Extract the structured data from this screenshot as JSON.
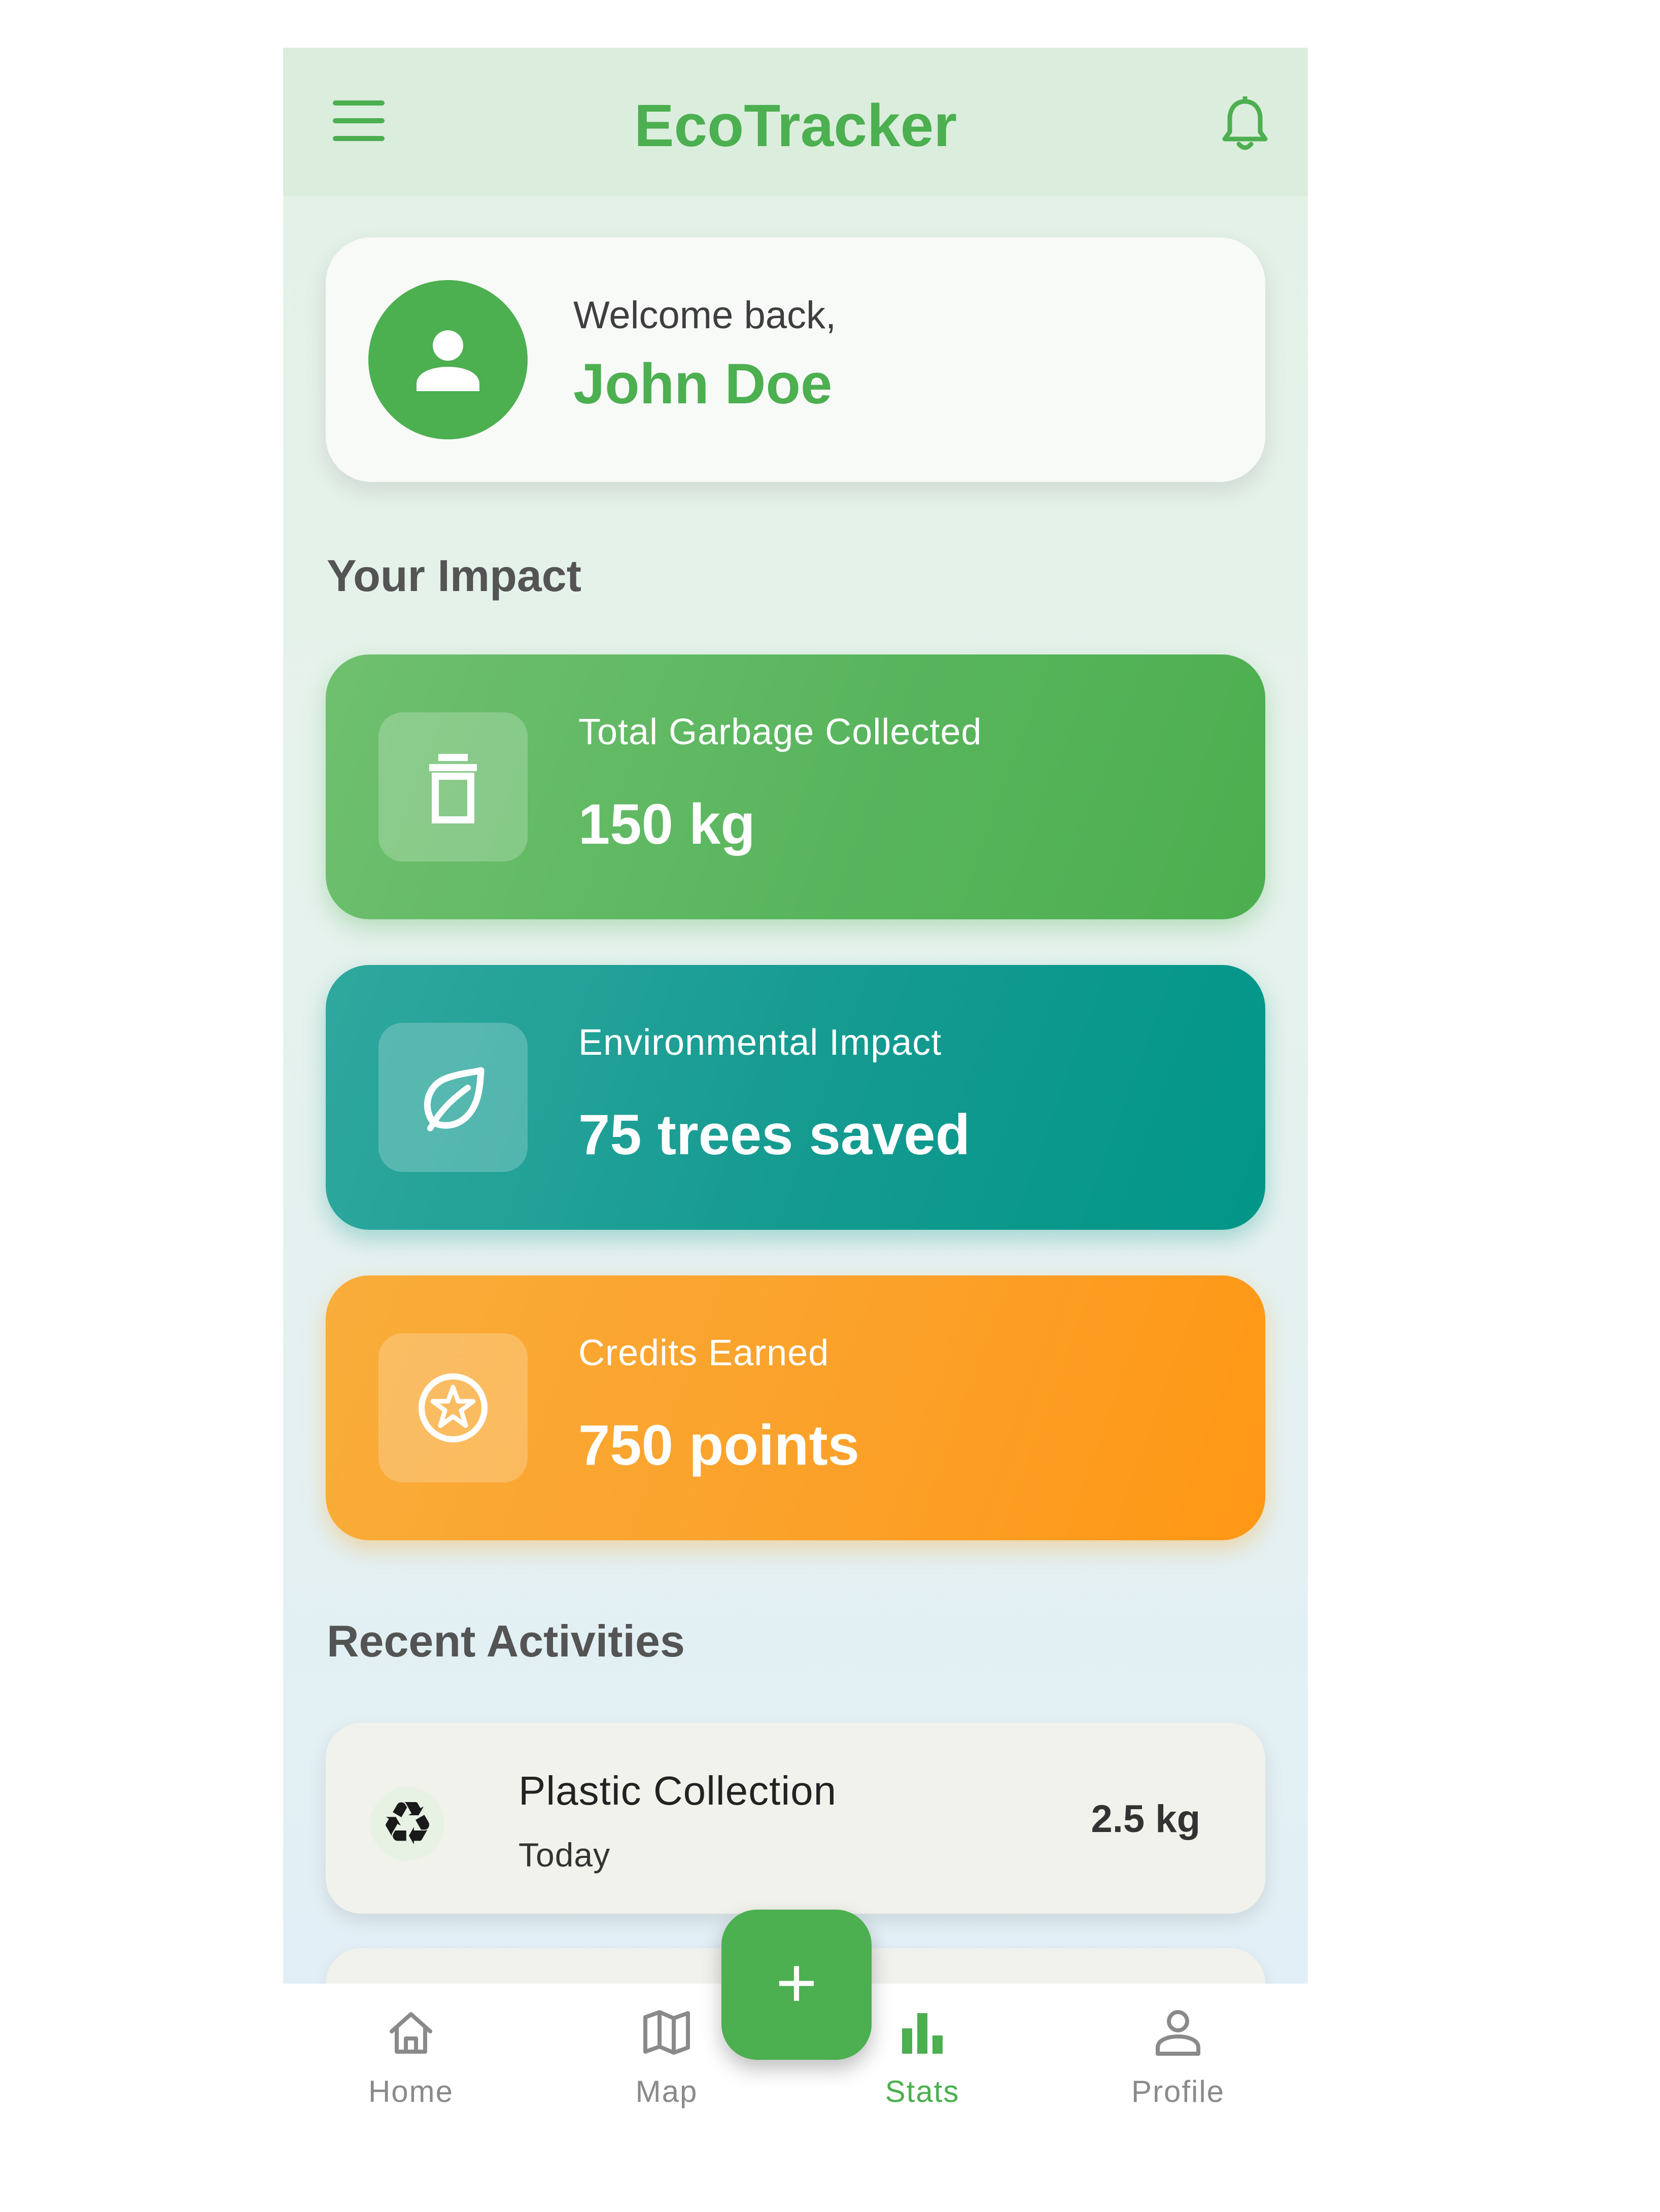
{
  "app": {
    "title": "EcoTracker",
    "brand_color": "#4caf50",
    "menu_icon": "menu-icon",
    "notification_icon": "bell-icon"
  },
  "welcome": {
    "greeting": "Welcome back,",
    "user_name": "John Doe",
    "avatar_icon": "person-icon"
  },
  "impact": {
    "section_title": "Your Impact",
    "cards": [
      {
        "label": "Total Garbage Collected",
        "value": "150 kg",
        "icon": "trash-icon",
        "color": "#4caf50"
      },
      {
        "label": "Environmental Impact",
        "value": "75 trees saved",
        "icon": "leaf-icon",
        "color": "#009688"
      },
      {
        "label": "Credits Earned",
        "value": "750 points",
        "icon": "star-icon",
        "color": "#ff9800"
      }
    ]
  },
  "activities": {
    "section_title": "Recent Activities",
    "items": [
      {
        "title": "Plastic Collection",
        "date": "Today",
        "amount": "2.5 kg",
        "icon": "recycle-icon"
      }
    ]
  },
  "fab": {
    "label": "+",
    "icon": "plus-icon"
  },
  "bottom_nav": {
    "items": [
      {
        "label": "Home",
        "icon": "home-icon",
        "active": false
      },
      {
        "label": "Map",
        "icon": "map-icon",
        "active": false
      },
      {
        "label": "Stats",
        "icon": "bar-chart-icon",
        "active": true
      },
      {
        "label": "Profile",
        "icon": "person-outline-icon",
        "active": false
      }
    ]
  }
}
